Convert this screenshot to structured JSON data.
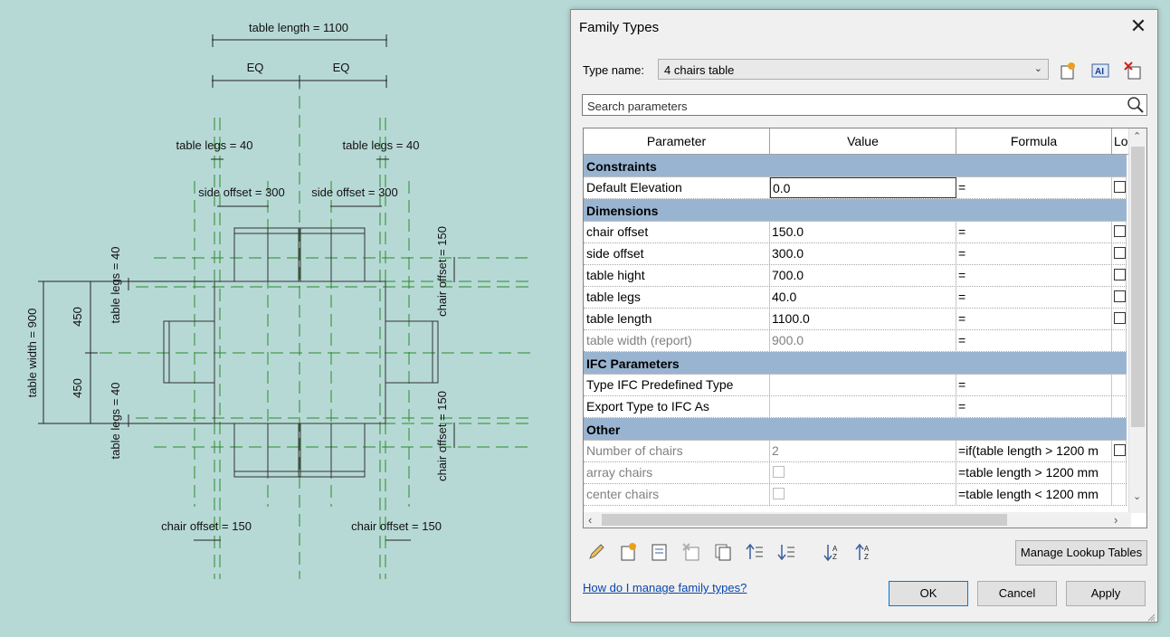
{
  "drawing": {
    "table_length": "table length = 1100",
    "eq": "EQ",
    "table_legs": "table legs = 40",
    "side_offset": "side offset = 300",
    "table_width": "table width = 900",
    "half_width": "450",
    "chair_offset": "chair offset = 150"
  },
  "dialog": {
    "title": "Family Types",
    "type_name_label": "Type name:",
    "type_name_value": "4 chairs table",
    "search_placeholder": "Search parameters",
    "columns": [
      "Parameter",
      "Value",
      "Formula",
      "Lo"
    ],
    "groups": [
      {
        "name": "Constraints",
        "rows": [
          {
            "param": "Default Elevation",
            "value": "0.0",
            "formula": "=",
            "lock": true,
            "editing": true
          }
        ]
      },
      {
        "name": "Dimensions",
        "rows": [
          {
            "param": "chair offset",
            "value": "150.0",
            "formula": "=",
            "lock": true
          },
          {
            "param": "side offset",
            "value": "300.0",
            "formula": "=",
            "lock": true
          },
          {
            "param": "table hight",
            "value": "700.0",
            "formula": "=",
            "lock": true
          },
          {
            "param": "table legs",
            "value": "40.0",
            "formula": "=",
            "lock": true
          },
          {
            "param": "table length",
            "value": "1100.0",
            "formula": "=",
            "lock": true
          },
          {
            "param": "table width (report)",
            "value": "900.0",
            "formula": "=",
            "lock": false,
            "gray": true
          }
        ]
      },
      {
        "name": "IFC Parameters",
        "rows": [
          {
            "param": "Type IFC Predefined Type",
            "value": "",
            "formula": "=",
            "lock": false
          },
          {
            "param": "Export Type to IFC As",
            "value": "",
            "formula": "=",
            "lock": false
          }
        ]
      },
      {
        "name": "Other",
        "rows": [
          {
            "param": "Number of chairs",
            "value": "2",
            "formula": "=if(table length > 1200 m",
            "lock": true,
            "gray": true
          },
          {
            "param": "array chairs",
            "value": "",
            "valueCheckbox": true,
            "formula": "=table length > 1200 mm",
            "lock": false,
            "gray": true
          },
          {
            "param": "center chairs",
            "value": "",
            "valueCheckbox": true,
            "formula": "=table length < 1200 mm",
            "lock": false,
            "gray": true
          }
        ]
      }
    ],
    "manage_lookup": "Manage Lookup Tables",
    "help_link": "How do I manage family types?",
    "ok": "OK",
    "cancel": "Cancel",
    "apply": "Apply",
    "toolbar_icons": [
      "edit-pencil-icon",
      "new-parameter-icon",
      "parameter-properties-icon",
      "delete-parameter-icon",
      "copy-parameter-icon",
      "move-up-icon",
      "move-down-icon",
      "sort-ascending-icon",
      "sort-descending-icon"
    ]
  }
}
